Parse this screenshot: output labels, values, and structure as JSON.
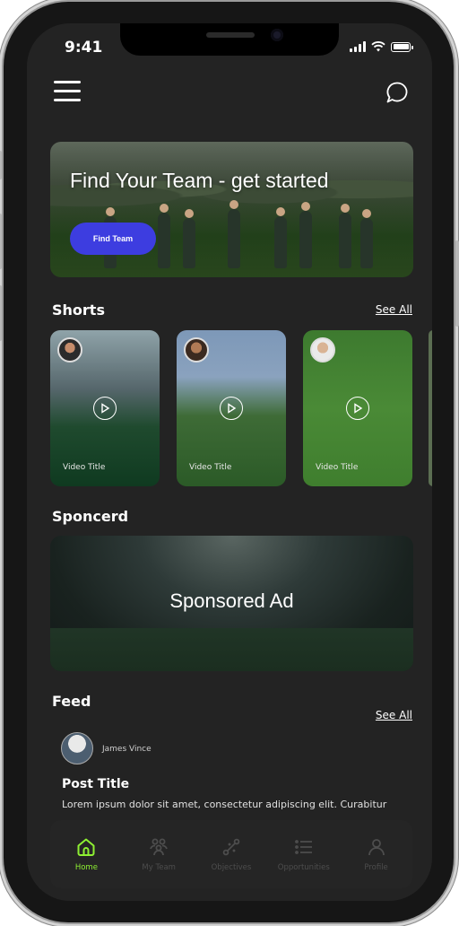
{
  "status_bar": {
    "time": "9:41"
  },
  "header": {
    "menu_icon": "hamburger-icon",
    "chat_icon": "chat-bubble-icon"
  },
  "hero": {
    "title": "Find Your Team - get started",
    "button_label": "Find Team",
    "button_color": "#3d3de0"
  },
  "shorts": {
    "title": "Shorts",
    "see_all": "See All",
    "items": [
      {
        "title": "Video Title"
      },
      {
        "title": "Video Title"
      },
      {
        "title": "Video Title"
      }
    ]
  },
  "sponsored": {
    "title": "Sponcerd",
    "ad_label": "Sponsored Ad"
  },
  "feed": {
    "title": "Feed",
    "see_all": "See All",
    "post": {
      "author": "James Vince",
      "title": "Post Title",
      "body": "Lorem ipsum dolor sit amet, consectetur adipiscing elit. Curabitur"
    }
  },
  "tabbar": {
    "active_color": "#8ef032",
    "items": [
      {
        "label": "Home",
        "icon": "home-icon",
        "active": true
      },
      {
        "label": "My Team",
        "icon": "team-icon",
        "active": false
      },
      {
        "label": "Objectives",
        "icon": "objectives-icon",
        "active": false
      },
      {
        "label": "Opportunities",
        "icon": "list-icon",
        "active": false
      },
      {
        "label": "Profile",
        "icon": "profile-icon",
        "active": false
      }
    ]
  }
}
